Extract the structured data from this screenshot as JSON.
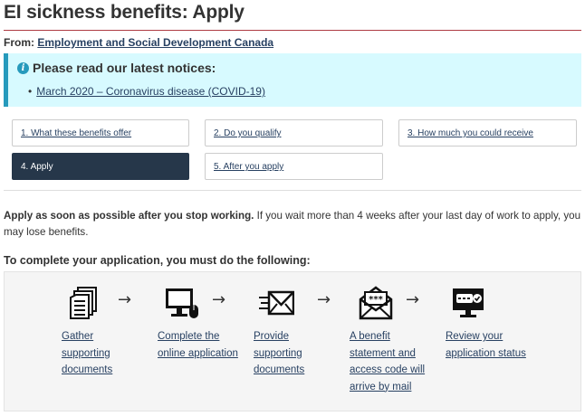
{
  "page": {
    "title": "EI sickness benefits: Apply",
    "from_label": "From:",
    "from_org": "Employment and Social Development Canada"
  },
  "notice": {
    "icon": "info-icon",
    "heading": "Please read our latest notices:",
    "items": [
      "March 2020 – Coronavirus disease (COVID-19)"
    ]
  },
  "steps": [
    {
      "label": "1. What these benefits offer",
      "active": false
    },
    {
      "label": "2. Do you qualify",
      "active": false
    },
    {
      "label": "3. How much you could receive",
      "active": false
    },
    {
      "label": "4. Apply",
      "active": true
    },
    {
      "label": "5. After you apply",
      "active": false
    }
  ],
  "intro": {
    "bold": "Apply as soon as possible after you stop working.",
    "rest": " If you wait more than 4 weeks after your last day of work to apply, you may lose benefits."
  },
  "process": {
    "heading": "To complete your application, you must do the following:",
    "items": [
      {
        "icon": "documents-icon",
        "label": "Gather supporting documents"
      },
      {
        "icon": "computer-icon",
        "label": "Complete the online application"
      },
      {
        "icon": "send-email-icon",
        "label": "Provide supporting documents"
      },
      {
        "icon": "letter-code-icon",
        "label": "A benefit statement and access code will arrive by mail"
      },
      {
        "icon": "monitor-status-icon",
        "label": "Review your application status"
      }
    ]
  },
  "colors": {
    "link": "#284162",
    "accent_rule": "#af3c43",
    "notice_bg": "#d7faff",
    "notice_border": "#269abc",
    "active_step": "#26374a"
  }
}
